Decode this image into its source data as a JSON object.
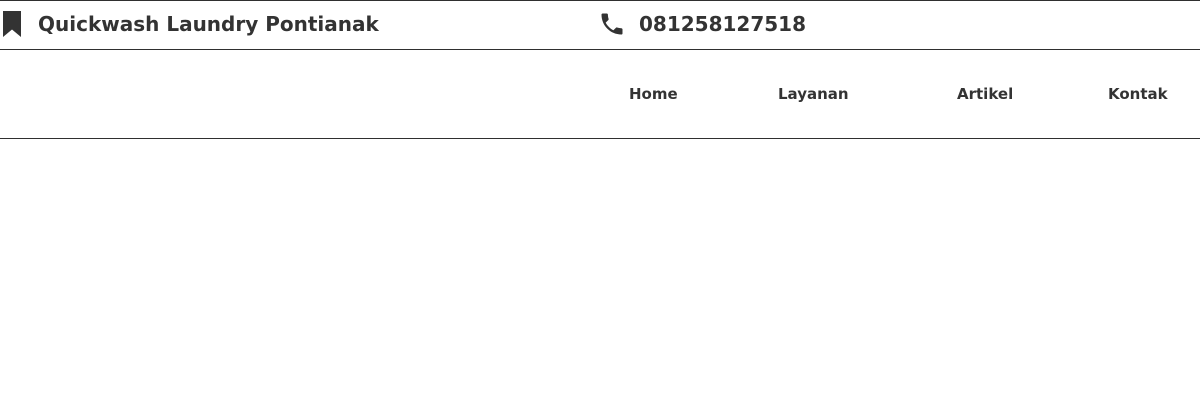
{
  "header": {
    "brand_icon": "bookmark-icon",
    "brand_name": "Quickwash Laundry Pontianak",
    "phone_icon": "phone-icon",
    "phone_number": "081258127518"
  },
  "nav": {
    "items": [
      {
        "label": "Home"
      },
      {
        "label": "Layanan"
      },
      {
        "label": "Artikel"
      },
      {
        "label": "Kontak"
      }
    ]
  },
  "colors": {
    "text": "#333333",
    "border": "#2f2f2f",
    "background": "#ffffff"
  }
}
